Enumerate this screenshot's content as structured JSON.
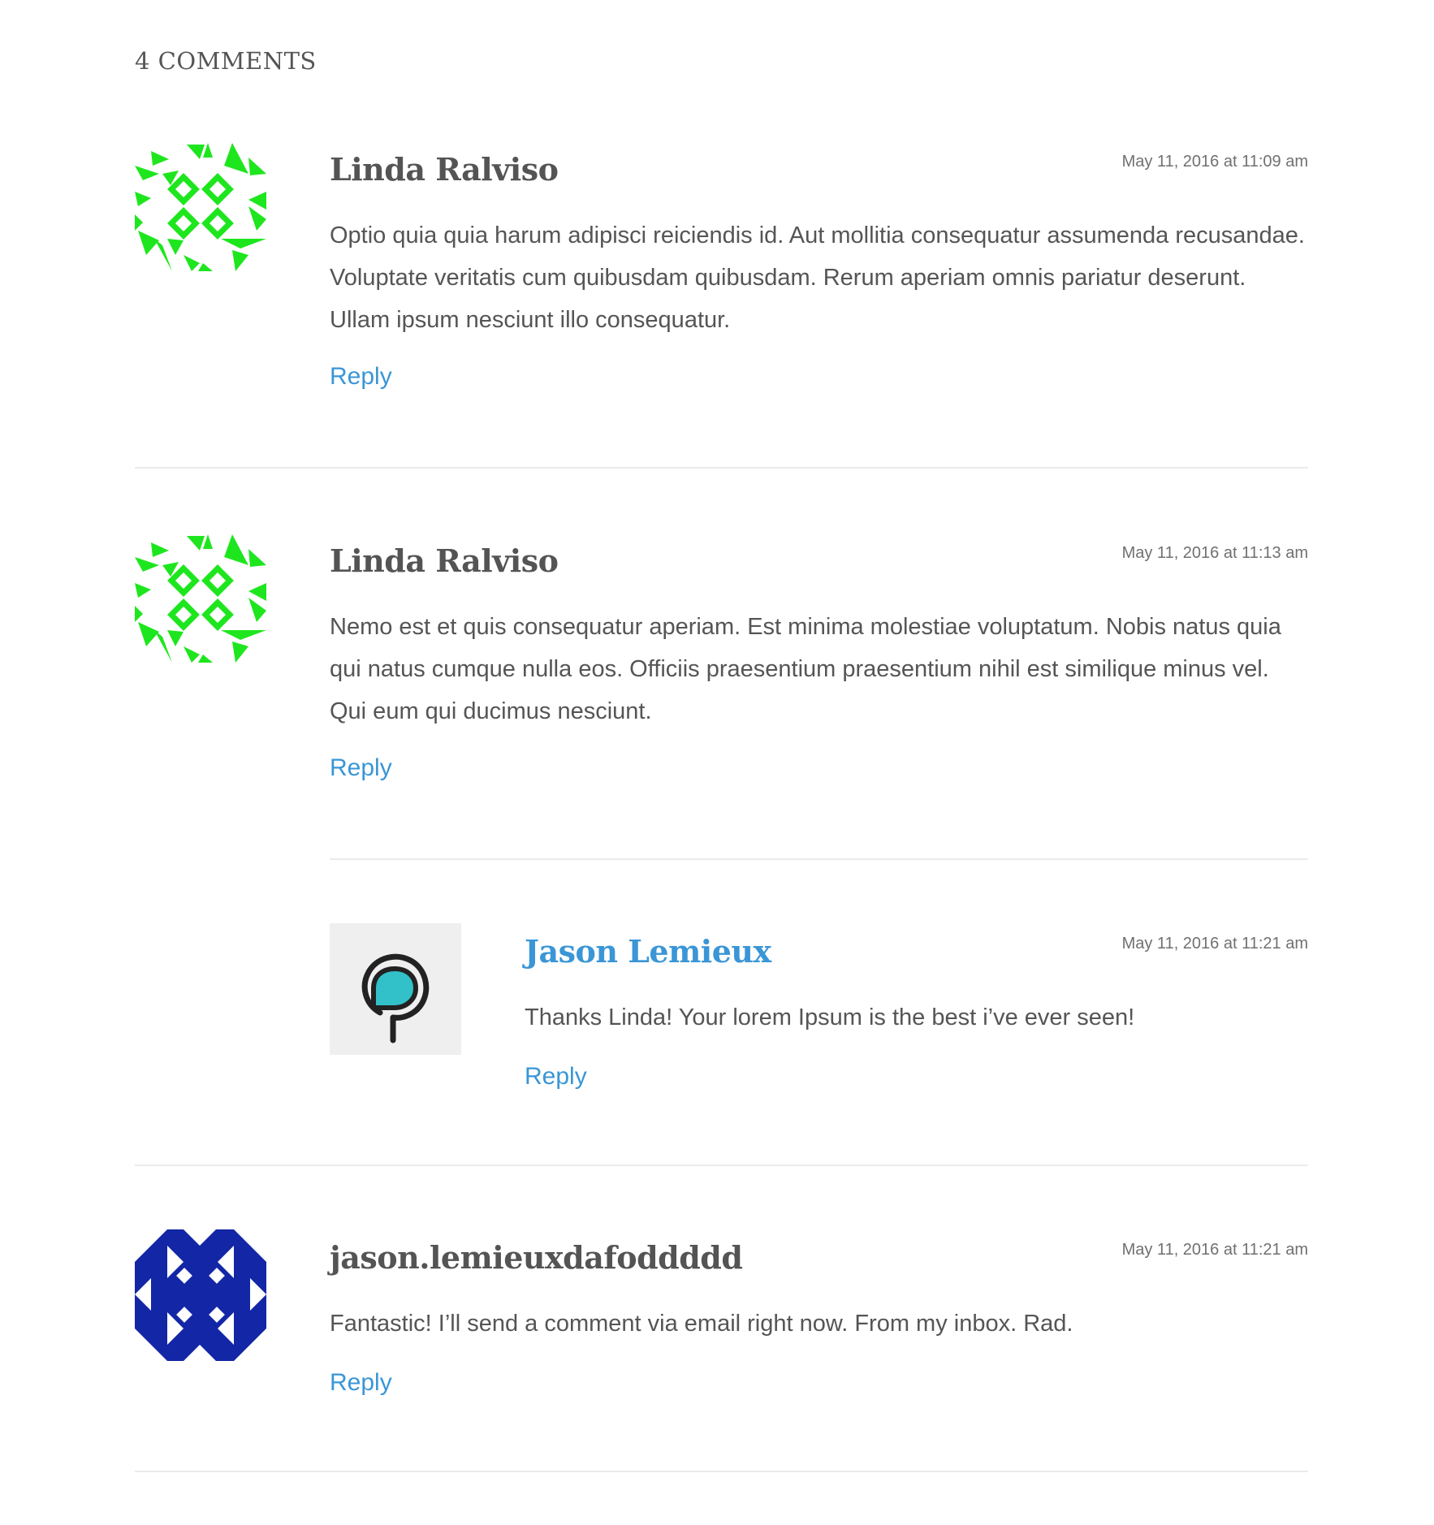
{
  "comments_heading": "4 COMMENTS",
  "colors": {
    "link": "#3a96d6",
    "text": "#555555",
    "divider": "#ebebeb",
    "identicon_green": "#1ee61e",
    "identicon_blue": "#1226a6",
    "avatar_bg": "#efefef",
    "avatar_teal": "#33c1c9"
  },
  "comments": [
    {
      "author": "Linda Ralviso",
      "date": "May 11, 2016 at 11:09 am",
      "text": "Optio quia quia harum adipisci reiciendis id. Aut mollitia consequatur assumenda recusandae. Voluptate veritatis cum quibusdam quibusdam. Rerum aperiam omnis pariatur deserunt. Ullam ipsum nesciunt illo consequatur.",
      "reply": "Reply",
      "avatar": "green-identicon"
    },
    {
      "author": "Linda Ralviso",
      "date": "May 11, 2016 at 11:13 am",
      "text": "Nemo est et quis consequatur aperiam. Est minima molestiae voluptatum. Nobis natus quia qui natus cumque nulla eos. Officiis praesentium praesentium nihil est similique minus vel. Qui eum qui ducimus nesciunt.",
      "reply": "Reply",
      "avatar": "green-identicon"
    },
    {
      "author": "Jason Lemieux",
      "date": "May 11, 2016 at 11:21 am",
      "text": "Thanks Linda! Your lorem Ipsum is the best i’ve ever seen!",
      "reply": "Reply",
      "avatar": "speech-bubble-logo",
      "is_reply": true
    },
    {
      "author": "jason.lemieuxdafoddddd",
      "date": "May 11, 2016 at 11:21 am",
      "text": "Fantastic! I’ll send a comment via email right now. From my inbox. Rad.",
      "reply": "Reply",
      "avatar": "blue-identicon"
    }
  ]
}
